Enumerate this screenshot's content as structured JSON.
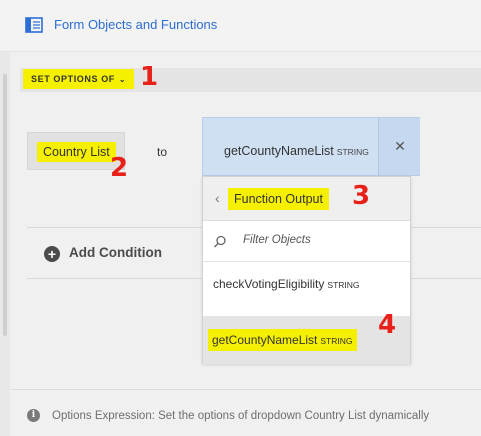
{
  "header": {
    "title": "Form Objects and Functions",
    "icon": "form-objects-icon"
  },
  "rule": {
    "set_options_label": "SET OPTIONS OF",
    "source_field": "Country List",
    "connector": "to",
    "selected_function": "getCountyNameList",
    "selected_function_type": "STRING"
  },
  "conditions": {
    "add_label": "Add Condition"
  },
  "dropdown": {
    "category": "Function Output",
    "search_placeholder": "Filter Objects",
    "items": [
      {
        "name": "checkVotingEligibility",
        "type": "STRING"
      },
      {
        "name": "getCountyNameList",
        "type": "STRING",
        "selected": true
      }
    ]
  },
  "footer": {
    "text": "Options Expression: Set the options of dropdown Country List dynamically"
  },
  "annotations": [
    "1",
    "2",
    "3",
    "4"
  ],
  "colors": {
    "highlight": "#f5f000",
    "annotation": "#e8201a",
    "link": "#2c6ed5",
    "selected_chip": "#cfe0f3"
  }
}
